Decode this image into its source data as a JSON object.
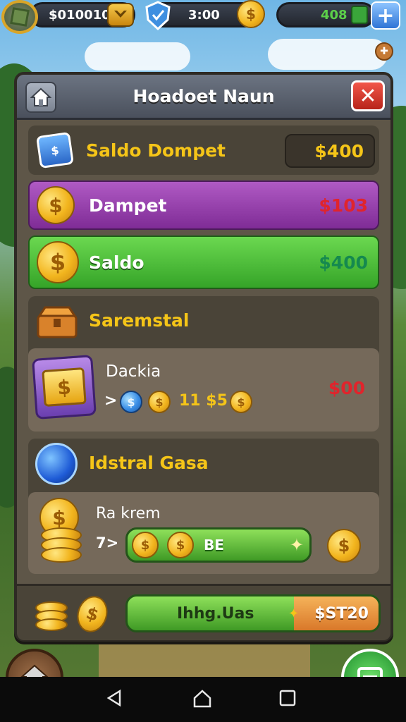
{
  "hud": {
    "currency_amount": "$010010",
    "timer": "3:00",
    "gems_amount": "408",
    "plus_label": "+"
  },
  "panel": {
    "title": "Hoadoet Naun",
    "close_label": "✕"
  },
  "balance": {
    "label": "Saldo Dompet",
    "value": "$400"
  },
  "rows": [
    {
      "label": "Dampet",
      "value": "$103",
      "color": "#9b3fb1",
      "value_color": "#e0242c"
    },
    {
      "label": "Saldo",
      "value": "$400",
      "color": "#4cbf3a",
      "value_color": "#15894f"
    }
  ],
  "section1": {
    "title": "Saremstal",
    "item_name": "Dackia",
    "item_arrow": ">",
    "item_amount": "11 $5",
    "item_value": "$00",
    "coin_symbol": "$"
  },
  "section2": {
    "title": "Idstral Gasa",
    "item_name": "Ra krem",
    "item_count": "7>",
    "bar_label": "BE"
  },
  "footer": {
    "button_label": "Ihhg.Uas",
    "price": "$ST20"
  },
  "colors": {
    "gold": "#f5c518",
    "accent_green": "#4cbf3a",
    "accent_purple": "#9b3fb1",
    "danger": "#e0242c"
  },
  "icons": [
    "home-icon",
    "close-icon",
    "coin-icon",
    "shield-icon",
    "gem-icon",
    "plus-icon",
    "wallet-icon",
    "chest-icon",
    "ticket-icon",
    "orb-icon",
    "coin-stack-icon",
    "shop-icon",
    "back-icon",
    "circle-home-icon",
    "recents-icon"
  ]
}
